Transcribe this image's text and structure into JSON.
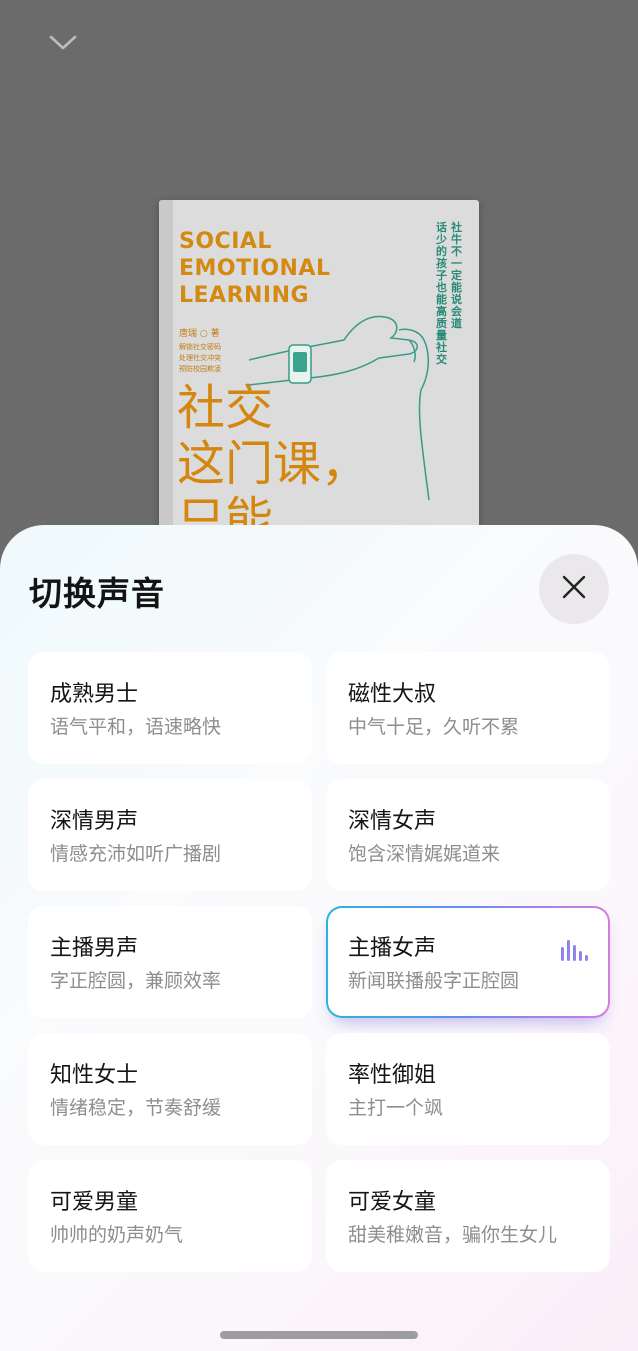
{
  "header": {
    "collapse_icon": "chevron-down-icon"
  },
  "book": {
    "title_en": "SOCIAL\nEMOTIONAL\nLEARNING",
    "author": "唐瑞 ○ 著",
    "subtitle_lines": "解锁社交密码\n处理社交冲突\n预防校园欺凌",
    "title_cn": "社交\n这门课，\n只能",
    "tagline_col1": "社牛不一定能说会道",
    "tagline_col2": "话少的孩子也能高质量社交"
  },
  "sheet": {
    "title": "切换声音",
    "close_icon": "close-icon",
    "voices": [
      {
        "name": "成熟男士",
        "desc": "语气平和，语速略快",
        "selected": false
      },
      {
        "name": "磁性大叔",
        "desc": "中气十足，久听不累",
        "selected": false
      },
      {
        "name": "深情男声",
        "desc": "情感充沛如听广播剧",
        "selected": false
      },
      {
        "name": "深情女声",
        "desc": "饱含深情娓娓道来",
        "selected": false
      },
      {
        "name": "主播男声",
        "desc": "字正腔圆，兼顾效率",
        "selected": false
      },
      {
        "name": "主播女声",
        "desc": "新闻联播般字正腔圆",
        "selected": true
      },
      {
        "name": "知性女士",
        "desc": "情绪稳定，节奏舒缓",
        "selected": false
      },
      {
        "name": "率性御姐",
        "desc": "主打一个飒",
        "selected": false
      },
      {
        "name": "可爱男童",
        "desc": "帅帅的奶声奶气",
        "selected": false
      },
      {
        "name": "可爱女童",
        "desc": "甜美稚嫩音，骗你生女儿",
        "selected": false
      }
    ],
    "playing_icon": "sound-wave-icon"
  },
  "colors": {
    "accent_start": "#28b6d8",
    "accent_end": "#d77be0",
    "book_title": "#d4860e",
    "book_tagline": "#2a8a78"
  }
}
